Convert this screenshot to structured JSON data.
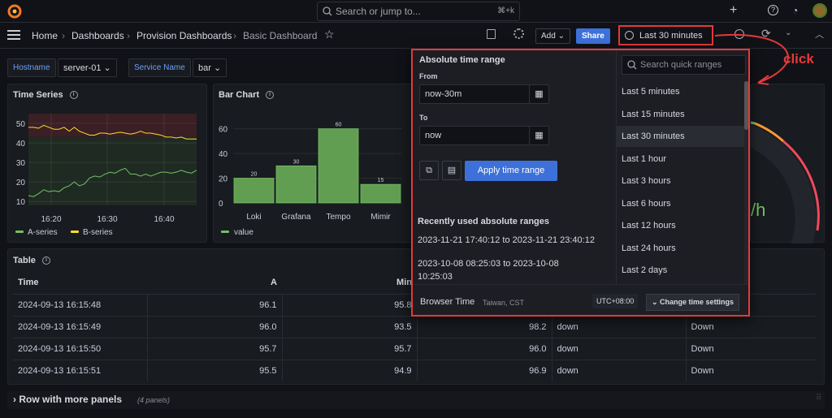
{
  "topbar": {
    "search_placeholder": "Search or jump to...",
    "shortcut": "⌘+k",
    "plus": "+"
  },
  "breadcrumb": [
    "Home",
    "Dashboards",
    "Provision Dashboards",
    "Basic Dashboard"
  ],
  "toolbar": {
    "add": "Add",
    "share": "Share",
    "time_range": "Last 30 minutes"
  },
  "variables": [
    {
      "label": "Hostname",
      "value": "server-01"
    },
    {
      "label": "Service Name",
      "value": "bar"
    }
  ],
  "timeseries": {
    "title": "Time Series",
    "chart_data": {
      "type": "line",
      "yticks": [
        10,
        20,
        30,
        40,
        50
      ],
      "xticks": [
        "16:20",
        "16:30",
        "16:40"
      ],
      "ylim": [
        8,
        55
      ],
      "thresholds": [
        {
          "from": 43,
          "color": "#3a1f24"
        },
        {
          "to": 43,
          "color": "#1f2b22"
        }
      ],
      "series": [
        {
          "name": "A-series",
          "color": "#73bf69",
          "values": [
            13,
            12.5,
            14,
            16,
            15,
            15.5,
            15,
            17,
            18,
            20,
            18,
            19,
            22,
            23,
            22.5,
            24,
            25,
            24.5,
            26,
            27,
            24,
            24,
            23,
            24,
            23,
            24,
            25,
            25,
            24.5,
            25,
            26,
            25,
            24.5,
            26
          ]
        },
        {
          "name": "B-series",
          "color": "#fade2a",
          "values": [
            48,
            48,
            47.5,
            49,
            48,
            47,
            47,
            48,
            46,
            48,
            46,
            45,
            44,
            44,
            45,
            45,
            44.5,
            45,
            45.5,
            45,
            44.5,
            45,
            46,
            45,
            45,
            44.5,
            44,
            43,
            43,
            42.5,
            43,
            42,
            42,
            42
          ]
        }
      ]
    }
  },
  "barchart": {
    "title": "Bar Chart",
    "chart_data": {
      "type": "bar",
      "categories": [
        "Loki",
        "Grafana",
        "Tempo",
        "Mimir"
      ],
      "values": [
        20,
        30,
        60,
        15
      ],
      "yticks": [
        0,
        20,
        40,
        60
      ],
      "ylim": [
        0,
        67
      ],
      "series_name": "value",
      "color": "#73bf69"
    }
  },
  "gauge": {
    "unit_fragment": "/h"
  },
  "table": {
    "title": "Table",
    "headers": [
      "Time",
      "A",
      "Min"
    ],
    "rows": [
      [
        "2024-09-13 16:15:48",
        "96.1",
        "95.8",
        "",
        "",
        ""
      ],
      [
        "2024-09-13 16:15:49",
        "96.0",
        "93.5",
        "98.2",
        "down",
        "Down"
      ],
      [
        "2024-09-13 16:15:50",
        "95.7",
        "95.7",
        "96.0",
        "down",
        "Down"
      ],
      [
        "2024-09-13 16:15:51",
        "95.5",
        "94.9",
        "96.9",
        "down",
        "Down"
      ]
    ]
  },
  "row": {
    "title": "Row with more panels",
    "count": "(4 panels)"
  },
  "popup": {
    "abs_title": "Absolute time range",
    "from_label": "From",
    "from_value": "now-30m",
    "to_label": "To",
    "to_value": "now",
    "apply": "Apply time range",
    "recent_title": "Recently used absolute ranges",
    "recent": [
      "2023-11-21 17:40:12 to 2023-11-21 23:40:12",
      "2023-10-08 08:25:03 to 2023-10-08 10:25:03"
    ],
    "quick_placeholder": "Search quick ranges",
    "quick": [
      "Last 5 minutes",
      "Last 15 minutes",
      "Last 30 minutes",
      "Last 1 hour",
      "Last 3 hours",
      "Last 6 hours",
      "Last 12 hours",
      "Last 24 hours",
      "Last 2 days"
    ],
    "selected_quick": "Last 30 minutes",
    "browser_time": "Browser Time",
    "tz": "Taiwan, CST",
    "utc": "UTC+08:00",
    "change": "Change time settings"
  },
  "annotation": {
    "text": "click",
    "color": "#e5393a"
  }
}
